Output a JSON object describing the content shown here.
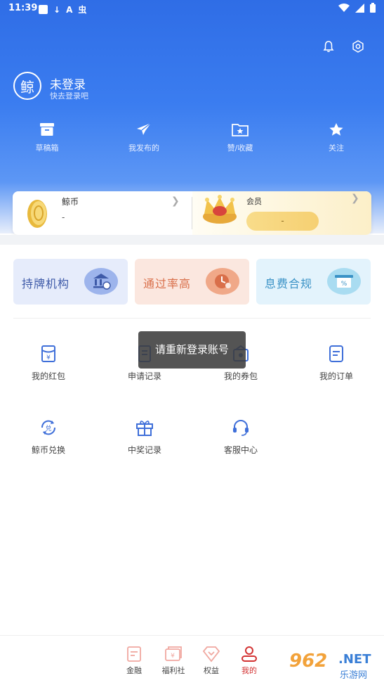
{
  "status_bar": {
    "time": "11:39",
    "left_glyphs": [
      "↓",
      "A",
      "虫"
    ]
  },
  "profile": {
    "avatar_char": "鲸",
    "name": "未登录",
    "subtitle": "快去登录吧"
  },
  "quick_actions": [
    {
      "label": "草稿箱",
      "icon": "draft-box-icon"
    },
    {
      "label": "我发布的",
      "icon": "paper-plane-icon"
    },
    {
      "label": "赞/收藏",
      "icon": "star-folder-icon"
    },
    {
      "label": "关注",
      "icon": "star-icon"
    }
  ],
  "wallet": {
    "coin_label": "鲸币",
    "coin_value": "-",
    "vip_label": "会员",
    "vip_value": "-"
  },
  "features": [
    {
      "text": "持牌机构",
      "icon": "bank-icon"
    },
    {
      "text": "通过率高",
      "icon": "clock-icon"
    },
    {
      "text": "息费合规",
      "icon": "percent-card-icon"
    }
  ],
  "menu": [
    {
      "label": "我的红包",
      "icon": "red-packet-icon"
    },
    {
      "label": "申请记录",
      "icon": "apply-record-icon"
    },
    {
      "label": "我的券包",
      "icon": "coupon-wallet-icon"
    },
    {
      "label": "我的订单",
      "icon": "order-icon"
    },
    {
      "label": "鲸币兑换",
      "icon": "exchange-icon"
    },
    {
      "label": "中奖记录",
      "icon": "gift-icon"
    },
    {
      "label": "客服中心",
      "icon": "headset-icon"
    }
  ],
  "toast": "请重新登录账号",
  "bottom_nav": [
    {
      "label": "金融",
      "icon": "finance-icon",
      "active": false
    },
    {
      "label": "福利社",
      "icon": "welfare-icon",
      "active": false
    },
    {
      "label": "权益",
      "icon": "diamond-icon",
      "active": false
    },
    {
      "label": "我的",
      "icon": "person-icon",
      "active": true
    }
  ],
  "watermark": {
    "number": "962",
    "domain": ".NET",
    "cn": "乐游网"
  },
  "colors": {
    "header_blue": "#3b7df0",
    "menu_icon_blue": "#3f6fd9",
    "active_red": "#d33232",
    "vip_gold": "#f6d072"
  }
}
